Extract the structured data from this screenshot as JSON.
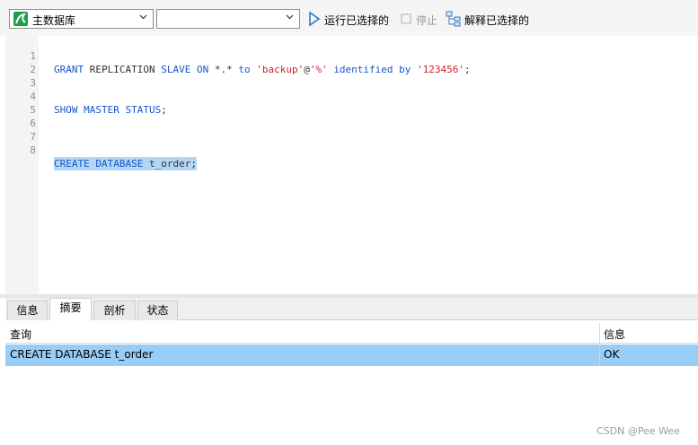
{
  "toolbar": {
    "connection_select": {
      "value": "主数据库",
      "icon": "mysql-connection-icon"
    },
    "schema_select": {
      "value": ""
    },
    "run_selected_label": "运行已选择的",
    "stop_label": "停止",
    "explain_selected_label": "解释已选择的",
    "accent": "#1a55c8"
  },
  "editor": {
    "line_numbers": [
      "1",
      "2",
      "3",
      "4",
      "5",
      "6",
      "7",
      "8"
    ],
    "line1": {
      "kw1": "GRANT",
      "p1": " REPLICATION ",
      "kw2": "SLAVE ON",
      "p2": " *.* ",
      "kw3": "to",
      "p3": " ",
      "s1": "'backup'",
      "p4": "@",
      "s2": "'%'",
      "p5": " ",
      "kw4": "identified by",
      "p6": " ",
      "s3": "'123456'",
      "p7": ";"
    },
    "line4": {
      "kw1": "SHOW MASTER STATUS",
      "p1": ";"
    },
    "line8": {
      "kw1": "CREATE DATABASE",
      "p1": " t_order;"
    }
  },
  "results": {
    "tabs": [
      "信息",
      "摘要",
      "剖析",
      "状态"
    ],
    "active_tab": "摘要",
    "columns": [
      "查询",
      "信息"
    ],
    "rows": [
      {
        "query": "CREATE DATABASE t_order",
        "info": "OK"
      }
    ],
    "selected_row_color": "#99cdf6"
  },
  "watermark": "CSDN @Pee Wee"
}
